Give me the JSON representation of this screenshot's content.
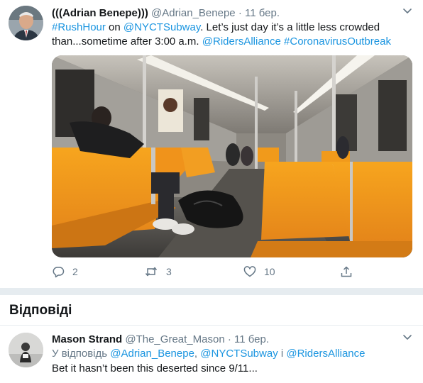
{
  "tweet": {
    "display_name": "(((Adrian Benepe)))",
    "handle": "@Adrian_Benepe",
    "separator": "·",
    "date": "11 бер.",
    "text_line1": [
      {
        "t": "#RushHour",
        "link": true
      },
      {
        "t": " on ",
        "link": false
      },
      {
        "t": "@NYCTSubway",
        "link": true
      },
      {
        "t": ". Let’s just day it’s a little less crowded",
        "link": false
      }
    ],
    "text_line2": [
      {
        "t": "than...sometime after 3:00 a.m. ",
        "link": false
      },
      {
        "t": "@RidersAlliance",
        "link": true
      },
      {
        "t": " ",
        "link": false
      },
      {
        "t": "#CoronavirusOutbreak",
        "link": true
      }
    ],
    "actions": {
      "reply_count": "2",
      "retweet_count": "3",
      "like_count": "10"
    },
    "icons": {
      "reply": "reply-icon",
      "retweet": "retweet-icon",
      "like": "heart-icon",
      "share": "share-icon",
      "more": "chevron-down-icon"
    }
  },
  "replies_heading": "Відповіді",
  "reply": {
    "display_name": "Mason Strand",
    "handle": "@The_Great_Mason",
    "separator": "·",
    "date": "11 бер.",
    "replying_prefix": "У відповідь ",
    "replying_user1": "@Adrian_Benepe",
    "replying_sep": ", ",
    "replying_user2": "@NYCTSubway",
    "replying_and": " і ",
    "replying_user3": "@RidersAlliance",
    "text": "Bet it hasn’t been this deserted since 9/11..."
  },
  "colors": {
    "link": "#1b95e0",
    "muted": "#657786",
    "text": "#14171a",
    "separator": "#e6ecf0",
    "seat": "#f39c12"
  }
}
